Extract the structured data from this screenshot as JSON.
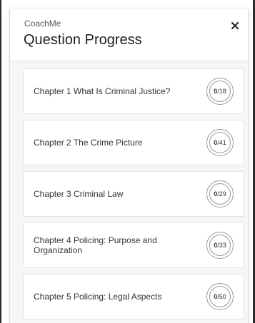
{
  "app": {
    "name": "CoachMe",
    "title": "Question Progress"
  },
  "close_icon": "close-icon",
  "chapters": [
    {
      "label": "Chapter 1 What Is Criminal Justice?",
      "answered": "0",
      "total": "/18",
      "progress": 0
    },
    {
      "label": "Chapter 2 The Crime Picture",
      "answered": "0",
      "total": "/41",
      "progress": 0
    },
    {
      "label": "Chapter 3 Criminal Law",
      "answered": "0",
      "total": "/29",
      "progress": 0
    },
    {
      "label": "Chapter 4 Policing: Purpose and Organization",
      "answered": "0",
      "total": "/33",
      "progress": 0
    },
    {
      "label": "Chapter 5 Policing: Legal Aspects",
      "answered": "0",
      "total": "/50",
      "progress": 0
    }
  ],
  "colors": {
    "ring": "#9a9a9a",
    "list_background": "#f6f6f6"
  }
}
